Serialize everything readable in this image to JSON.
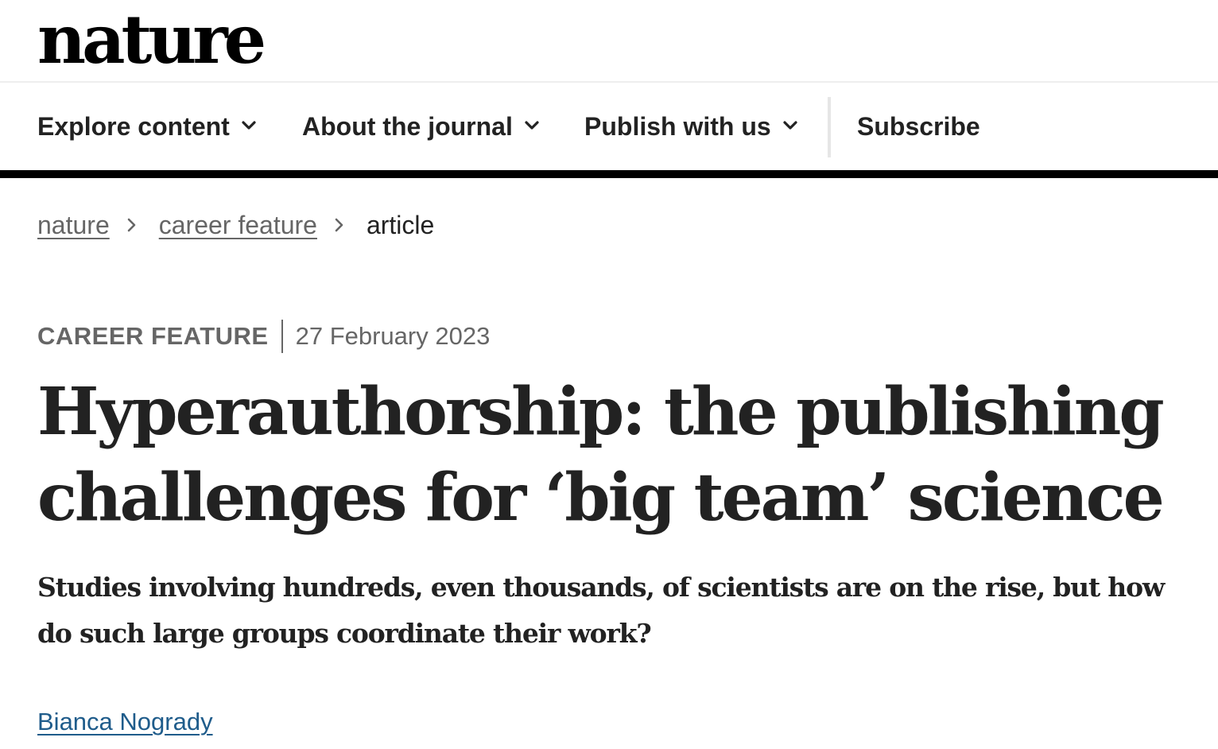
{
  "site": {
    "logo_text": "nature"
  },
  "nav": {
    "items": [
      {
        "label": "Explore content",
        "has_dropdown": true,
        "icon": "chevron-down-icon"
      },
      {
        "label": "About the journal",
        "has_dropdown": true,
        "icon": "chevron-down-icon"
      },
      {
        "label": "Publish with us",
        "has_dropdown": true,
        "icon": "chevron-down-icon"
      }
    ],
    "subscribe_label": "Subscribe"
  },
  "breadcrumb": {
    "items": [
      {
        "label": "nature",
        "link": true
      },
      {
        "label": "career feature",
        "link": true
      },
      {
        "label": "article",
        "link": false
      }
    ],
    "separator_icon": "chevron-right-icon"
  },
  "article": {
    "type": "CAREER FEATURE",
    "date": "27 February 2023",
    "title_line1": "Hyperauthorship: the publishing",
    "title_line2": "challenges for ‘big team’ science",
    "standfirst": "Studies involving hundreds, even thousands, of scientists are on the rise, but how do such large groups coordinate their work?",
    "author": "Bianca Nogrady"
  },
  "colors": {
    "text": "#222222",
    "muted": "#666666",
    "link_author": "#1f5c8b",
    "nav_rule": "#000000",
    "divider": "#e6e6e6"
  }
}
